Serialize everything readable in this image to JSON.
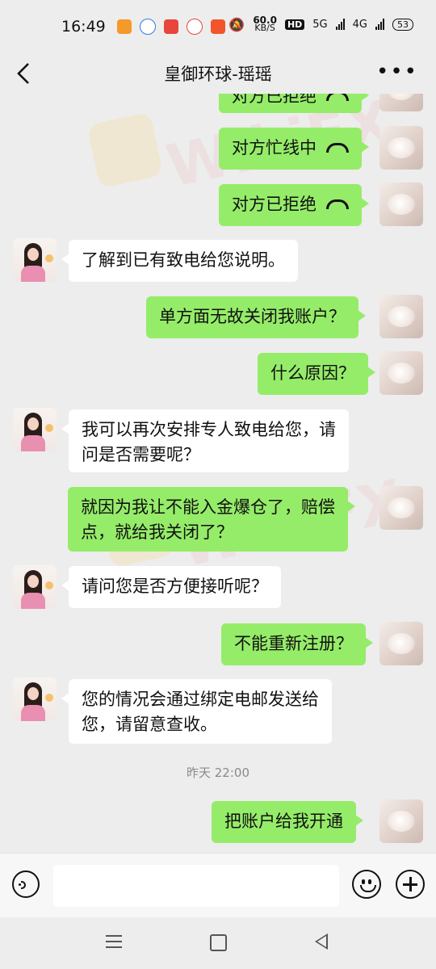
{
  "status_bar": {
    "time": "16:49",
    "net_speed_value": "60.0",
    "net_speed_unit": "KB/S",
    "hd_label": "HD",
    "network_5g": "5G",
    "network_4g": "4G",
    "battery": "53"
  },
  "header": {
    "title": "皇御环球-瑶瑶",
    "more_label": "•••"
  },
  "messages": [
    {
      "from": "self",
      "text": "对方已拒绝",
      "call_icon": true
    },
    {
      "from": "self",
      "text": "对方忙线中",
      "call_icon": true
    },
    {
      "from": "self",
      "text": "对方已拒绝",
      "call_icon": true
    },
    {
      "from": "other",
      "text": "了解到已有致电给您说明。"
    },
    {
      "from": "self",
      "text": "单方面无故关闭我账户？"
    },
    {
      "from": "self",
      "text": "什么原因？"
    },
    {
      "from": "other",
      "lines": [
        "我可以再次安排专人致电给您，请",
        "问是否需要呢？"
      ]
    },
    {
      "from": "self",
      "lines": [
        "就因为我让不能入金爆仓了，赔偿",
        "点，就给我关闭了？"
      ]
    },
    {
      "from": "other",
      "text": "请问您是否方便接听呢？"
    },
    {
      "from": "self",
      "text": "不能重新注册？"
    },
    {
      "from": "other",
      "lines": [
        "您的情况会通过绑定电邮发送给",
        "您，请留意查收。"
      ]
    },
    {
      "from": "timestamp",
      "text": "昨天 22:00"
    },
    {
      "from": "self",
      "text": "把账户给我开通"
    }
  ],
  "watermark": "WikiFX",
  "icons": {
    "back": "chevron-left-icon",
    "voice": "voice-input-icon",
    "emoji": "emoji-icon",
    "plus": "plus-icon",
    "call": "phone-hangup-icon"
  },
  "colors": {
    "self_bubble": "#95ec69",
    "other_bubble": "#ffffff",
    "background": "#ededed"
  }
}
